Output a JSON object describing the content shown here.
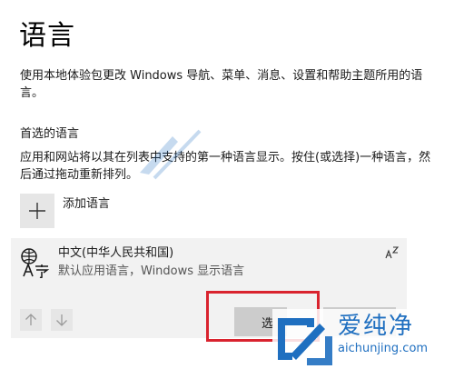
{
  "page": {
    "title": "语言",
    "description": "使用本地体验包更改 Windows 导航、菜单、消息、设置和帮助主题所用的语言。"
  },
  "preferred": {
    "heading": "首选的语言",
    "description": "应用和网站将以其在列表中支持的第一种语言显示。按住(或选择)一种语言，然后通过拖动重新排列。",
    "add_label": "添加语言"
  },
  "languages": [
    {
      "name": "中文(中华人民共和国)",
      "subtitle": "默认应用语言，Windows 显示语言"
    }
  ],
  "buttons": {
    "options_label": "选"
  },
  "watermark": {
    "brand": "爱纯净",
    "url": "aichunjing.com"
  },
  "icons": {
    "add": "plus-icon",
    "language": "language-character-icon",
    "text_format": "az-text-icon",
    "move_up": "arrow-up-icon",
    "move_down": "arrow-down-icon"
  },
  "colors": {
    "highlight": "#d9232e",
    "tile": "#e6e6e6",
    "panel": "#f2f2f2",
    "watermark": "#1f6fc0"
  }
}
